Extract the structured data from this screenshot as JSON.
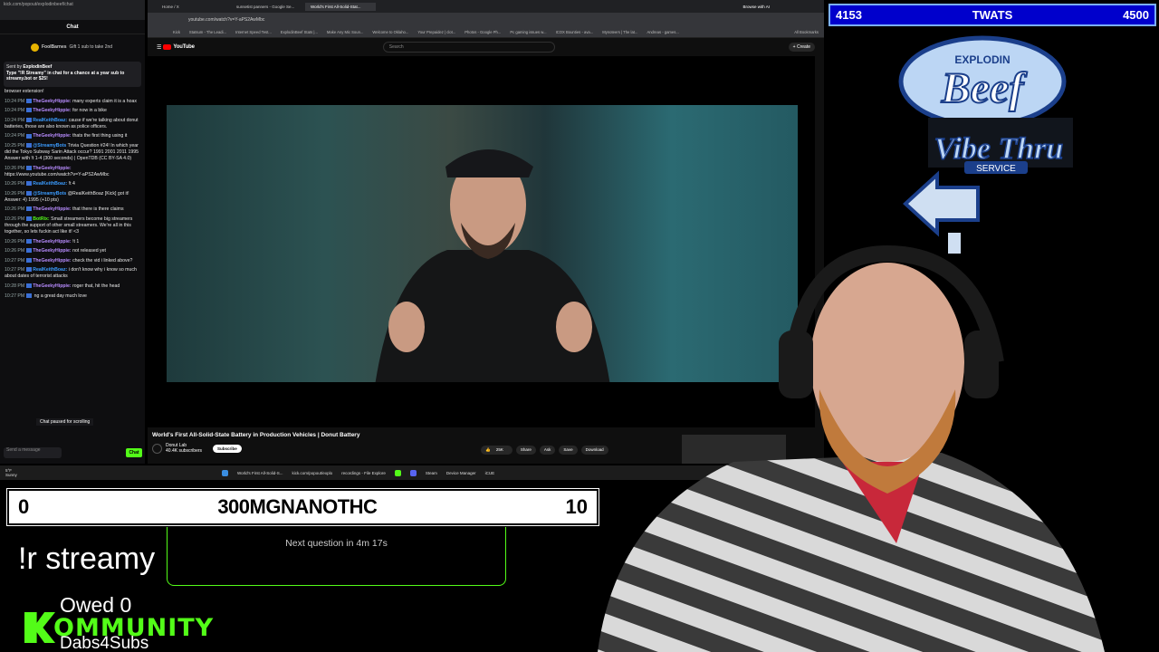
{
  "chat": {
    "browser_url": "kick.com/popout/explodinbeef/chat",
    "title": "Chat",
    "gift_user": "FoolBarnes",
    "gift_text": "Gift 1 sub to take 2nd",
    "pinned_by": "Sent by",
    "pinned_by_user": "ExplodinBeef",
    "pinned_text": "Type \"!R Streamy\" in chat for a chance at a year sub to streamy.bot or $25!",
    "pinned_tail": "browser extension!",
    "messages": [
      {
        "time": "10:24 PM",
        "user": "TheGeekyHippie:",
        "text": "many experts claim it is a hoax",
        "color": "#b88cff"
      },
      {
        "time": "10:24 PM",
        "user": "TheGeekyHippie:",
        "text": "for now in a bike",
        "color": "#b88cff"
      },
      {
        "time": "10:24 PM",
        "user": "RealKeithBoaz:",
        "text": "cause if we're talking about donut batteries, those are also known as police officers.",
        "color": "#3b9cff"
      },
      {
        "time": "10:24 PM",
        "user": "TheGeekyHippie:",
        "text": "thats the first thing using it",
        "color": "#b88cff"
      },
      {
        "time": "10:25 PM",
        "user": "@StreamyBots",
        "text": "Trivia Question #24! In which year did the Tokyo Subway Sarin Attack occur? 1991 2001 2011 1995 Answer with !t 1-4 (300 seconds) | OpenTDB (CC BY-SA 4.0)",
        "color": "#3b9cff"
      },
      {
        "time": "10:26 PM",
        "user": "TheGeekyHippie:",
        "text": "https://www.youtube.com/watch?v=Y-aPS2AwMbc",
        "color": "#b88cff"
      },
      {
        "time": "10:26 PM",
        "user": "RealKeithBoaz:",
        "text": "!t 4",
        "color": "#3b9cff"
      },
      {
        "time": "10:26 PM",
        "user": "@StreamyBots",
        "text": "@RealKeithBoaz [Kick] got it! Answer: 4) 1995 (+10 pts)",
        "color": "#3b9cff"
      },
      {
        "time": "10:26 PM",
        "user": "TheGeekyHippie:",
        "text": "that there is there claims",
        "color": "#b88cff"
      },
      {
        "time": "10:26 PM",
        "user": "BotRix:",
        "text": "Small streamers become big streamers through the support of other small streamers. We're all in this together, so lets fuckin act like it! <3",
        "color": "#53fc18"
      },
      {
        "time": "10:26 PM",
        "user": "TheGeekyHippie:",
        "text": "!t 1",
        "color": "#b88cff"
      },
      {
        "time": "10:26 PM",
        "user": "TheGeekyHippie:",
        "text": "not released yet",
        "color": "#b88cff"
      },
      {
        "time": "10:27 PM",
        "user": "TheGeekyHippie:",
        "text": "check the vid i linked above?",
        "color": "#b88cff"
      },
      {
        "time": "10:27 PM",
        "user": "RealKeithBoaz:",
        "text": "i don't know why i know so much about dates of terrorist attacks",
        "color": "#3b9cff"
      },
      {
        "time": "10:28 PM",
        "user": "TheGeekyHippie:",
        "text": "roger that, hit the head",
        "color": "#b88cff"
      },
      {
        "time": "10:27 PM",
        "user": "",
        "text": "ng a great day much love",
        "color": "#b88cff"
      }
    ],
    "paused": "Chat paused for scrolling",
    "input_placeholder": "Send a message",
    "send_label": "Chat"
  },
  "browser": {
    "tabs": [
      "Home / X",
      "sunsetist panners - Google Se...",
      "World's First All-Solid-Stat..."
    ],
    "ai_label": "Browse with AI",
    "url": "youtube.com/watch?v=Y-aPS2AwMbc",
    "bookmarks": [
      "Kick",
      "Statsum - The Leadi...",
      "Internet Speed Test...",
      "ExplodinBeef Stats |...",
      "Make Any Mic Soun...",
      "Welcome to Oklaho...",
      "Your Prepaidez | clot...",
      "Photos - Google Ph...",
      "Pc gaming issues w...",
      "ICOX Bounties - ava...",
      "Mynoteers | The lat...",
      "Andreas - games..."
    ],
    "all_bookmarks": "All Bookmarks",
    "yt_logo": "YouTube",
    "search_placeholder": "Search",
    "create": "+ Create",
    "video_title": "World's First All-Solid-State Battery in Production Vehicles | Donut Battery",
    "channel_name": "Donut Lab",
    "channel_subs": "40.4K subscribers",
    "subscribe": "Subscribe",
    "likes": "25K",
    "share": "Share",
    "ask": "Ask",
    "save": "Save",
    "download": "Download"
  },
  "taskbar": {
    "weather_temp": "5°F",
    "weather_desc": "Sunny",
    "items": [
      "World's First All-Solid-S...",
      "kick.com/popout/explo",
      "recordings - File Explore",
      "Steam",
      "Device Manager",
      "iCUE"
    ]
  },
  "overlay": {
    "score_left": "4153",
    "score_label": "TWATS",
    "score_right": "4500",
    "logo_top": "EXPLODIN",
    "logo_main": "Beef",
    "logo_sub": "Vibe Thru",
    "logo_service": "SERVICE",
    "trivia_left": "0",
    "trivia_center": "300MGNANOTHC",
    "trivia_right": "10",
    "streamy": "!r streamy",
    "next_question": "Next question in 4m 17s",
    "owed": "Owed 0",
    "kommunity": "OMMUNITY",
    "dabs": "Dabs4Subs"
  },
  "colors": {
    "kick_green": "#53fc18",
    "scorebar_blue": "#0000cc",
    "yt_red": "#ff0000"
  }
}
